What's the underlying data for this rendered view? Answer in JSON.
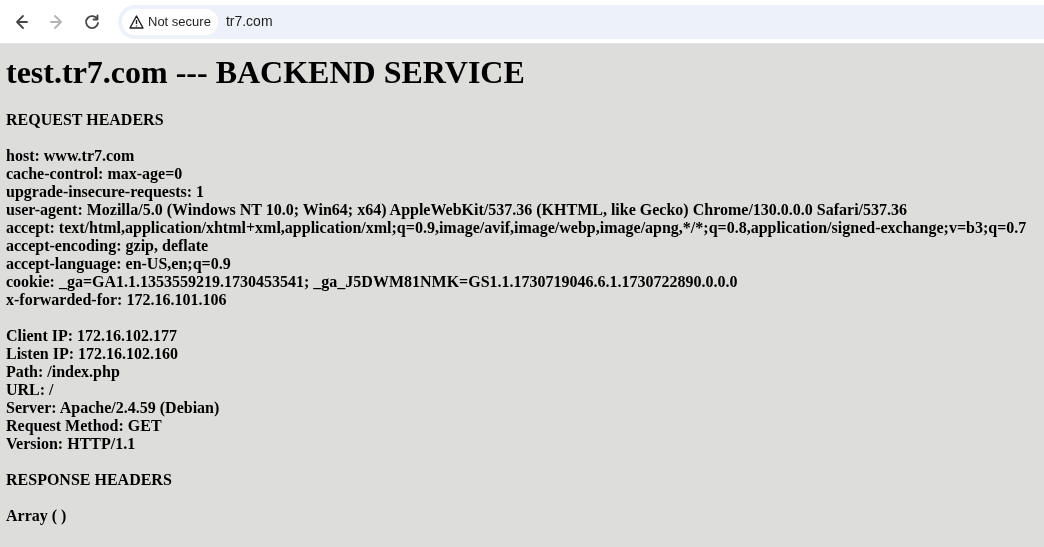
{
  "browser": {
    "back_disabled": false,
    "forward_disabled": true,
    "security_label": "Not secure",
    "url": "tr7.com"
  },
  "page": {
    "title": "test.tr7.com --- BACKEND SERVICE",
    "request_headers": {
      "heading": "REQUEST HEADERS",
      "lines": [
        "host: www.tr7.com",
        "cache-control: max-age=0",
        "upgrade-insecure-requests: 1",
        "user-agent: Mozilla/5.0 (Windows NT 10.0; Win64; x64) AppleWebKit/537.36 (KHTML, like Gecko) Chrome/130.0.0.0 Safari/537.36",
        "accept: text/html,application/xhtml+xml,application/xml;q=0.9,image/avif,image/webp,image/apng,*/*;q=0.8,application/signed-exchange;v=b3;q=0.7",
        "accept-encoding: gzip, deflate",
        "accept-language: en-US,en;q=0.9",
        "cookie: _ga=GA1.1.1353559219.1730453541; _ga_J5DWM81NMK=GS1.1.1730719046.6.1.1730722890.0.0.0",
        "x-forwarded-for: 172.16.101.106"
      ]
    },
    "server_info": {
      "lines": [
        "Client IP: 172.16.102.177",
        "Listen IP: 172.16.102.160",
        "Path: /index.php",
        "URL: /",
        "Server: Apache/2.4.59 (Debian)",
        "Request Method: GET",
        "Version: HTTP/1.1"
      ]
    },
    "response_headers": {
      "heading": "RESPONSE HEADERS",
      "body": "Array ( )"
    }
  }
}
